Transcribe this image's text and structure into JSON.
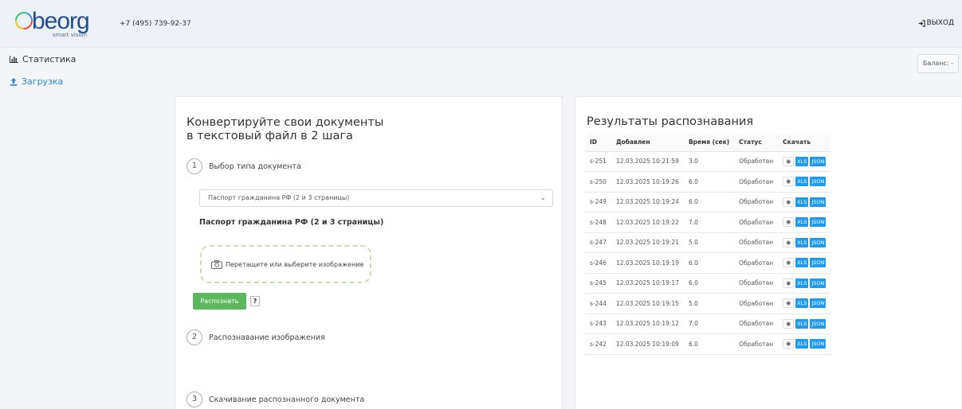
{
  "header": {
    "logo_text": "beorg",
    "logo_sub": "smart vision",
    "phone": "+7 (495) 739-92-37",
    "logout_label": "ВЫХОД"
  },
  "sidebar": {
    "items": [
      {
        "label": "Статистика",
        "icon": "bar-chart-icon"
      },
      {
        "label": "Загрузка",
        "icon": "upload-icon"
      }
    ]
  },
  "balance": {
    "label": "Баланс: -"
  },
  "converter": {
    "title_line1": "Конвертируйте свои документы",
    "title_line2": "в текстовый файл в 2 шага",
    "steps": [
      {
        "num": "1",
        "label": "Выбор типа документа"
      },
      {
        "num": "2",
        "label": "Распознавание изображения"
      },
      {
        "num": "3",
        "label": "Скачивание распознанного документа"
      }
    ],
    "select_value": "Паспорт гражданина РФ (2 и 3 страницы)",
    "doc_name": "Паспорт гражданина РФ (2 и 3 страницы)",
    "dropzone_text": "Перетащите или выберите изображение",
    "recognize_label": "Распознать",
    "help_label": "?"
  },
  "results": {
    "title": "Результаты распознавания",
    "columns": [
      "ID",
      "Добавлен",
      "Время (сек)",
      "Статус",
      "Скачать"
    ],
    "xls_label": "XLS",
    "json_label": "JSON",
    "rows": [
      {
        "id": "s-251",
        "added": "12.03.2025 10:21:59",
        "time": "3.0",
        "status": "Обработан"
      },
      {
        "id": "s-250",
        "added": "12.03.2025 10:19:26",
        "time": "6.0",
        "status": "Обработан"
      },
      {
        "id": "s-249",
        "added": "12.03.2025 10:19:24",
        "time": "6.0",
        "status": "Обработан"
      },
      {
        "id": "s-248",
        "added": "12.03.2025 10:19:22",
        "time": "7.0",
        "status": "Обработан"
      },
      {
        "id": "s-247",
        "added": "12.03.2025 10:19:21",
        "time": "5.0",
        "status": "Обработан"
      },
      {
        "id": "s-246",
        "added": "12.03.2025 10:19:19",
        "time": "6.0",
        "status": "Обработан"
      },
      {
        "id": "s-245",
        "added": "12.03.2025 10:19:17",
        "time": "6.0",
        "status": "Обработан"
      },
      {
        "id": "s-244",
        "added": "12.03.2025 10:19:15",
        "time": "5.0",
        "status": "Обработан"
      },
      {
        "id": "s-243",
        "added": "12.03.2025 10:19:12",
        "time": "7.0",
        "status": "Обработан"
      },
      {
        "id": "s-242",
        "added": "12.03.2025 10:19:09",
        "time": "6.0",
        "status": "Обработан"
      }
    ]
  },
  "colors": {
    "accent_blue": "#2b88d8",
    "button_green": "#5cb85c",
    "download_blue": "#1e9bf0",
    "dropzone_border": "#c8e0b0"
  }
}
